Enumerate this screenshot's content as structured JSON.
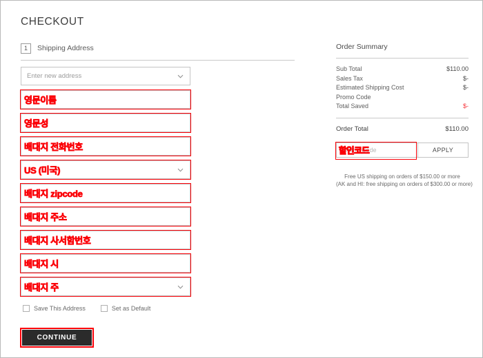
{
  "page": {
    "title": "CHECKOUT"
  },
  "shipping_section": {
    "step_number": "1",
    "step_label": "Shipping Address",
    "address_select": {
      "value": "Enter new address",
      "icon": "chevron-down-icon"
    },
    "fields": [
      {
        "name": "first-name",
        "placeholder": "",
        "annotation": "영문이름",
        "type": "text",
        "hollow": false
      },
      {
        "name": "last-name",
        "placeholder": "",
        "annotation": "영문성",
        "type": "text",
        "hollow": false
      },
      {
        "name": "phone-number",
        "placeholder": "",
        "annotation": "배대지 전화번호",
        "type": "text",
        "hollow": false
      },
      {
        "name": "country",
        "placeholder": "",
        "annotation": "US (미국)",
        "type": "select",
        "hollow": false
      },
      {
        "name": "zipcode",
        "placeholder": "",
        "annotation": "배대지 zipcode",
        "type": "text",
        "hollow": false
      },
      {
        "name": "address-line-1",
        "placeholder": "",
        "annotation": "배대지 주소",
        "type": "text",
        "hollow": false
      },
      {
        "name": "address-line-2",
        "placeholder": "",
        "annotation": "배대지 사서함번호",
        "type": "text",
        "hollow": false
      },
      {
        "name": "city",
        "placeholder": "",
        "annotation": "배대지 시",
        "type": "text",
        "hollow": false
      },
      {
        "name": "state",
        "placeholder": "",
        "annotation": "배대지 주",
        "type": "select",
        "hollow": false
      }
    ],
    "checkboxes": [
      {
        "name": "save-this-address",
        "label": "Save This Address",
        "checked": false
      },
      {
        "name": "set-as-default",
        "label": "Set as Default",
        "checked": false
      }
    ],
    "continue_label": "CONTINUE"
  },
  "order_summary": {
    "title": "Order Summary",
    "rows": [
      {
        "label": "Sub Total",
        "value": "$110.00",
        "highlight": false
      },
      {
        "label": "Sales Tax",
        "value": "$-",
        "highlight": false
      },
      {
        "label": "Estimated Shipping Cost",
        "value": "$-",
        "highlight": false
      },
      {
        "label": "Promo Code",
        "value": "",
        "highlight": false
      },
      {
        "label": "Total Saved",
        "value": "$-",
        "highlight": true
      }
    ],
    "order_total": {
      "label": "Order Total",
      "value": "$110.00"
    },
    "promo": {
      "placeholder": "Promo Code",
      "value": "",
      "apply_label": "APPLY",
      "annotation": "할인코드"
    },
    "shipping_note_line1": "Free US shipping on orders of $150.00 or more",
    "shipping_note_line2": "(AK and HI: free shipping on orders of $300.00 or more)"
  },
  "colors": {
    "annotation_red": "#fb0007",
    "saved_red": "#f6353b",
    "button_dark": "#2b2b2b",
    "border_gray": "#c4c4c4",
    "text_gray": "#5d5d5d"
  }
}
